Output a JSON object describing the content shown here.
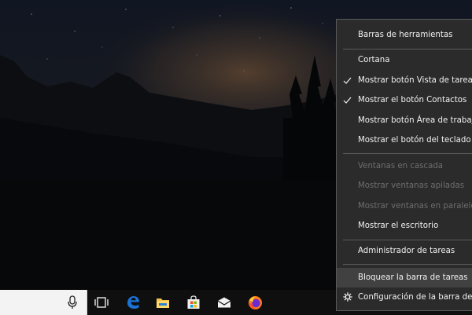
{
  "context_menu": {
    "items": [
      {
        "label": "Barras de herramientas",
        "enabled": true,
        "checked": false
      },
      {
        "label": "Cortana",
        "enabled": true,
        "checked": false
      },
      {
        "label": "Mostrar botón Vista de tareas",
        "enabled": true,
        "checked": true
      },
      {
        "label": "Mostrar el botón Contactos",
        "enabled": true,
        "checked": true
      },
      {
        "label": "Mostrar botón Área de trabajo de Windows Ink",
        "enabled": true,
        "checked": false
      },
      {
        "label": "Mostrar el botón del teclado táctil",
        "enabled": true,
        "checked": false
      },
      {
        "label": "Ventanas en cascada",
        "enabled": false,
        "checked": false
      },
      {
        "label": "Mostrar ventanas apiladas",
        "enabled": false,
        "checked": false
      },
      {
        "label": "Mostrar ventanas en paralelo",
        "enabled": false,
        "checked": false
      },
      {
        "label": "Mostrar el escritorio",
        "enabled": true,
        "checked": false
      },
      {
        "label": "Administrador de tareas",
        "enabled": true,
        "checked": false
      },
      {
        "label": "Bloquear la barra de tareas",
        "enabled": true,
        "checked": false,
        "highlighted": true
      },
      {
        "label": "Configuración de la barra de tareas",
        "enabled": true,
        "checked": false
      }
    ]
  },
  "taskbar": {
    "icons": [
      "microphone-icon",
      "task-view-icon",
      "edge-icon",
      "file-explorer-icon",
      "store-icon",
      "mail-icon",
      "firefox-icon"
    ]
  },
  "colors": {
    "menu_bg": "#2b2b2b",
    "menu_highlight": "#414141",
    "menu_text": "#f2f2f2",
    "menu_text_disabled": "#6e6e6e",
    "taskbar_bg": "#0f0f10",
    "edge_blue": "#1a73d4",
    "explorer_yellow": "#f5c24a"
  }
}
